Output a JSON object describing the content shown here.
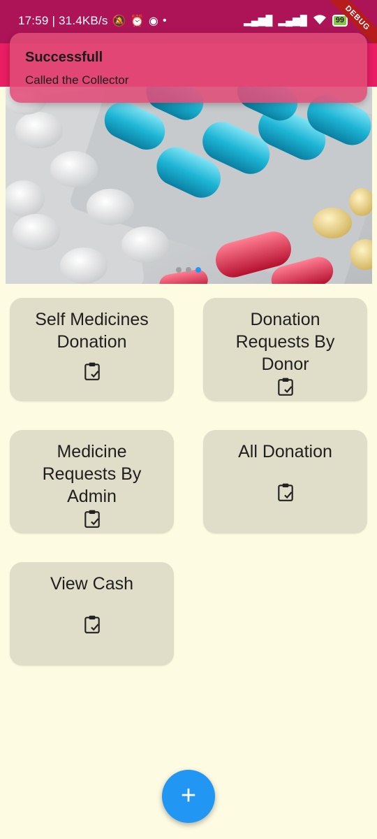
{
  "status_bar": {
    "time_speed": "17:59 | 31.4KB/s",
    "battery": "99",
    "debug_banner": "DEBUG"
  },
  "snackbar": {
    "title": "Successfull",
    "message": "Called the Collector"
  },
  "carousel": {
    "image": "medicine-pills-photo",
    "page_count": 3,
    "active_page": 3
  },
  "cards": [
    {
      "label": "Self Medicines Donation",
      "icon": "clipboard-check-icon"
    },
    {
      "label": "Donation Requests By Donor",
      "icon": "clipboard-check-icon"
    },
    {
      "label": "Medicine Requests By Admin",
      "icon": "clipboard-check-icon"
    },
    {
      "label": "All Donation",
      "icon": "clipboard-check-icon"
    },
    {
      "label": "View Cash",
      "icon": "clipboard-check-icon"
    }
  ],
  "fab": {
    "label": "+",
    "icon": "plus-icon"
  },
  "colors": {
    "status_bar": "#ad1457",
    "app_bar": "#e91e63",
    "background": "#fdfbe1",
    "card": "#e0ddc8",
    "fab": "#2196f3"
  }
}
